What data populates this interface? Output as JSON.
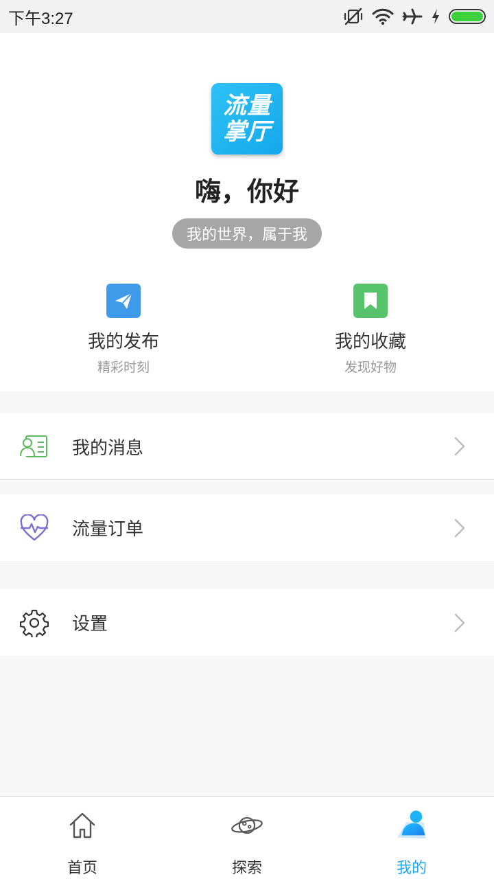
{
  "status_bar": {
    "time": "下午3:27"
  },
  "profile": {
    "logo_line1": "流量",
    "logo_line2": "掌厅",
    "greeting": "嗨，你好",
    "slogan": "我的世界，属于我"
  },
  "quick_actions": [
    {
      "title": "我的发布",
      "subtitle": "精彩时刻",
      "icon": "paper-plane-icon"
    },
    {
      "title": "我的收藏",
      "subtitle": "发现好物",
      "icon": "bookmark-icon"
    }
  ],
  "menu": [
    {
      "label": "我的消息",
      "icon": "contact-card-icon"
    },
    {
      "label": "流量订单",
      "icon": "heart-pulse-icon"
    },
    {
      "label": "设置",
      "icon": "gear-icon"
    }
  ],
  "tabs": [
    {
      "label": "首页",
      "icon": "home-icon",
      "active": false
    },
    {
      "label": "探索",
      "icon": "planet-icon",
      "active": false
    },
    {
      "label": "我的",
      "icon": "user-icon",
      "active": true
    }
  ],
  "colors": {
    "accent": "#1da6f2",
    "publish_icon": "#3f9ae9",
    "favorite_icon": "#57c36b",
    "message_icon": "#5cb85c",
    "order_icon": "#7b6fd0",
    "battery": "#3ad23a"
  }
}
